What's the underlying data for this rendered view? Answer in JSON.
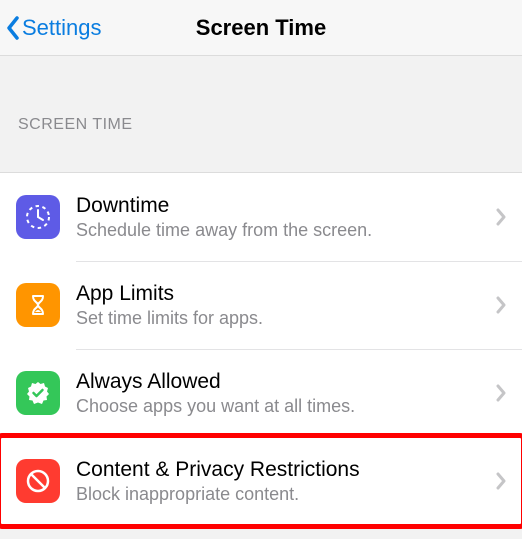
{
  "nav": {
    "back_label": "Settings",
    "title": "Screen Time"
  },
  "section_header": "SCREEN TIME",
  "rows": [
    {
      "icon": "clock-icon",
      "title": "Downtime",
      "subtitle": "Schedule time away from the screen."
    },
    {
      "icon": "hourglass-icon",
      "title": "App Limits",
      "subtitle": "Set time limits for apps."
    },
    {
      "icon": "check-seal-icon",
      "title": "Always Allowed",
      "subtitle": "Choose apps you want at all times."
    },
    {
      "icon": "no-entry-icon",
      "title": "Content & Privacy Restrictions",
      "subtitle": "Block inappropriate content."
    }
  ],
  "highlight_row_index": 3
}
